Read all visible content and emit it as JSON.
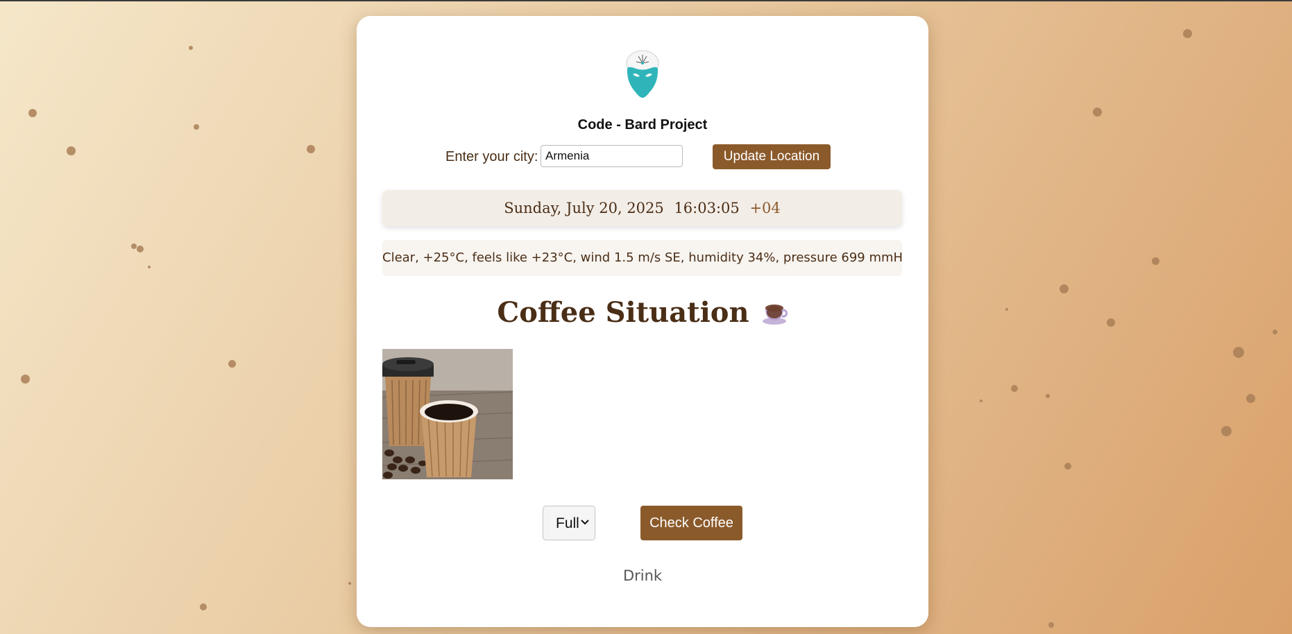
{
  "header": {
    "project_title": "Code - Bard Project"
  },
  "location": {
    "label": "Enter your city:",
    "input_value": "Armenia",
    "button_label": "Update Location"
  },
  "datetime": {
    "date": "Sunday, July 20, 2025",
    "time": "16:03:05",
    "timezone": "+04"
  },
  "weather": {
    "summary": "Clear, +25°C, feels like +23°C, wind 1.5 m/s SE, humidity 34%, pressure 699 mmHg"
  },
  "coffee": {
    "heading": "Coffee Situation",
    "heading_icon": "coffee-cup-icon",
    "status_options": [
      "Full"
    ],
    "selected_status": "Full",
    "check_button_label": "Check Coffee",
    "result_text": "Drink"
  },
  "colors": {
    "accent": "#8b5a2b",
    "heading_text": "#4a2e16",
    "logo_teal": "#2fb5b9"
  }
}
